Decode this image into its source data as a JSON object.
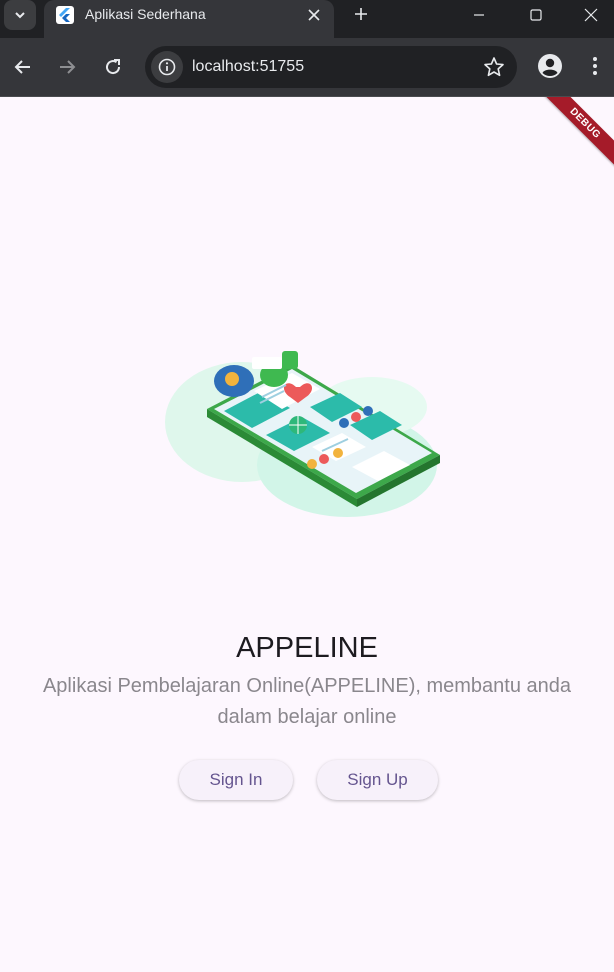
{
  "browser": {
    "tab_title": "Aplikasi Sederhana",
    "url": "localhost:51755",
    "icons": [
      "tab-dropdown-icon",
      "flutter-favicon",
      "close-icon",
      "plus-icon",
      "minimize-icon",
      "maximize-icon",
      "window-close-icon",
      "back-arrow-icon",
      "forward-arrow-icon",
      "reload-icon",
      "info-icon",
      "star-icon",
      "profile-icon",
      "kebab-menu-icon"
    ]
  },
  "app": {
    "debug_banner": "DEBUG",
    "title": "APPELINE",
    "subtitle_line1": "Aplikasi Pembelajaran Online(APPELINE), membantu anda",
    "subtitle_line2": "dalam belajar online",
    "sign_in_label": "Sign In",
    "sign_up_label": "Sign Up"
  },
  "colors": {
    "page_background": "#fdf7fe",
    "button_text": "#65558f",
    "debug_banner": "#a51b29",
    "illustration_green": "#3fb950"
  }
}
